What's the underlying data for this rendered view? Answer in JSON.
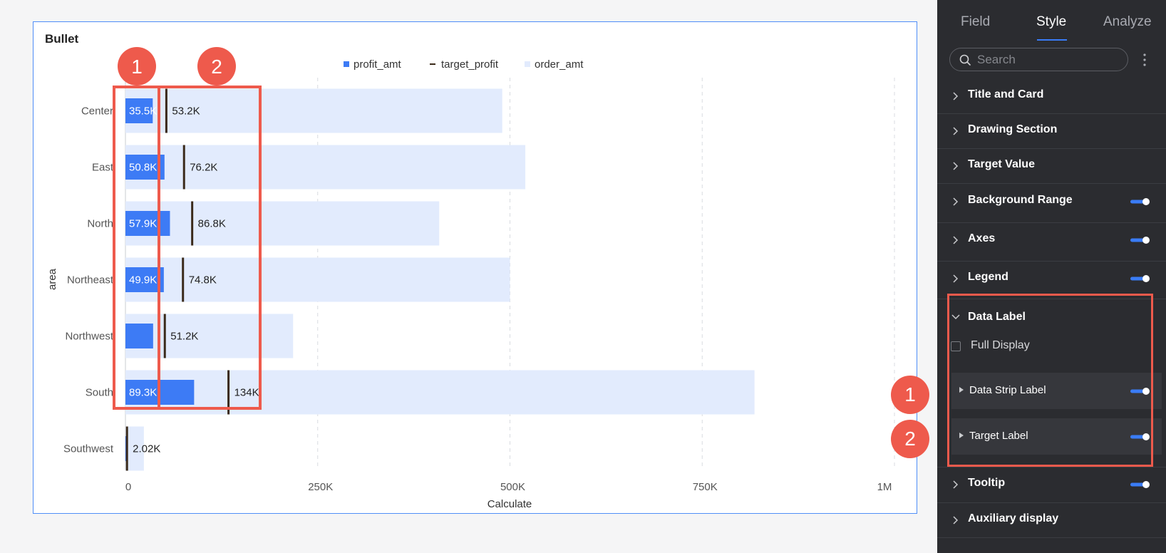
{
  "card": {
    "title": "Bullet"
  },
  "chart_data": {
    "type": "bar",
    "orientation": "horizontal",
    "ylabel": "area",
    "xlabel": "Calculate",
    "categories": [
      "Center",
      "East",
      "North",
      "Northeast",
      "Northwest",
      "South",
      "Southwest"
    ],
    "series": [
      {
        "name": "profit_amt",
        "values": [
          35500,
          50800,
          57900,
          49900,
          36000,
          89300,
          2020
        ]
      },
      {
        "name": "target_profit",
        "values": [
          53200,
          76200,
          86800,
          74800,
          51200,
          134000,
          2020
        ]
      },
      {
        "name": "order_amt",
        "values": [
          490000,
          520000,
          408000,
          500000,
          218000,
          818000,
          24000
        ]
      }
    ],
    "profit_labels": [
      "35.5K",
      "50.8K",
      "57.9K",
      "49.9K",
      "",
      "89.3K",
      ""
    ],
    "target_labels": [
      "53.2K",
      "76.2K",
      "86.8K",
      "74.8K",
      "51.2K",
      "134K",
      "2.02K"
    ],
    "xticks": [
      "0",
      "250K",
      "500K",
      "750K",
      "1M"
    ],
    "xlim": [
      0,
      1000000
    ],
    "grid": "vertical dashed",
    "legend_position": "top-center",
    "annotations": [
      "1",
      "2"
    ],
    "colors": {
      "profit": "#3d7bf5",
      "target": "#3a2a1a",
      "order": "#e2ebfd",
      "highlight": "#ee5a4c"
    }
  },
  "panel": {
    "tabs": [
      {
        "label": "Field"
      },
      {
        "label": "Style"
      },
      {
        "label": "Analyze"
      }
    ],
    "search": {
      "placeholder": "Search"
    },
    "sections": {
      "title_card": "Title and Card",
      "drawing_section": "Drawing Section",
      "target_value": "Target Value",
      "background_range": "Background Range",
      "axes": "Axes",
      "legend": "Legend",
      "data_label": "Data Label",
      "full_display": "Full Display",
      "data_strip_label": "Data Strip Label",
      "target_label": "Target Label",
      "tooltip": "Tooltip",
      "auxiliary_display": "Auxiliary display"
    },
    "badges": [
      "1",
      "2"
    ],
    "accent": "#3a7cf6"
  }
}
